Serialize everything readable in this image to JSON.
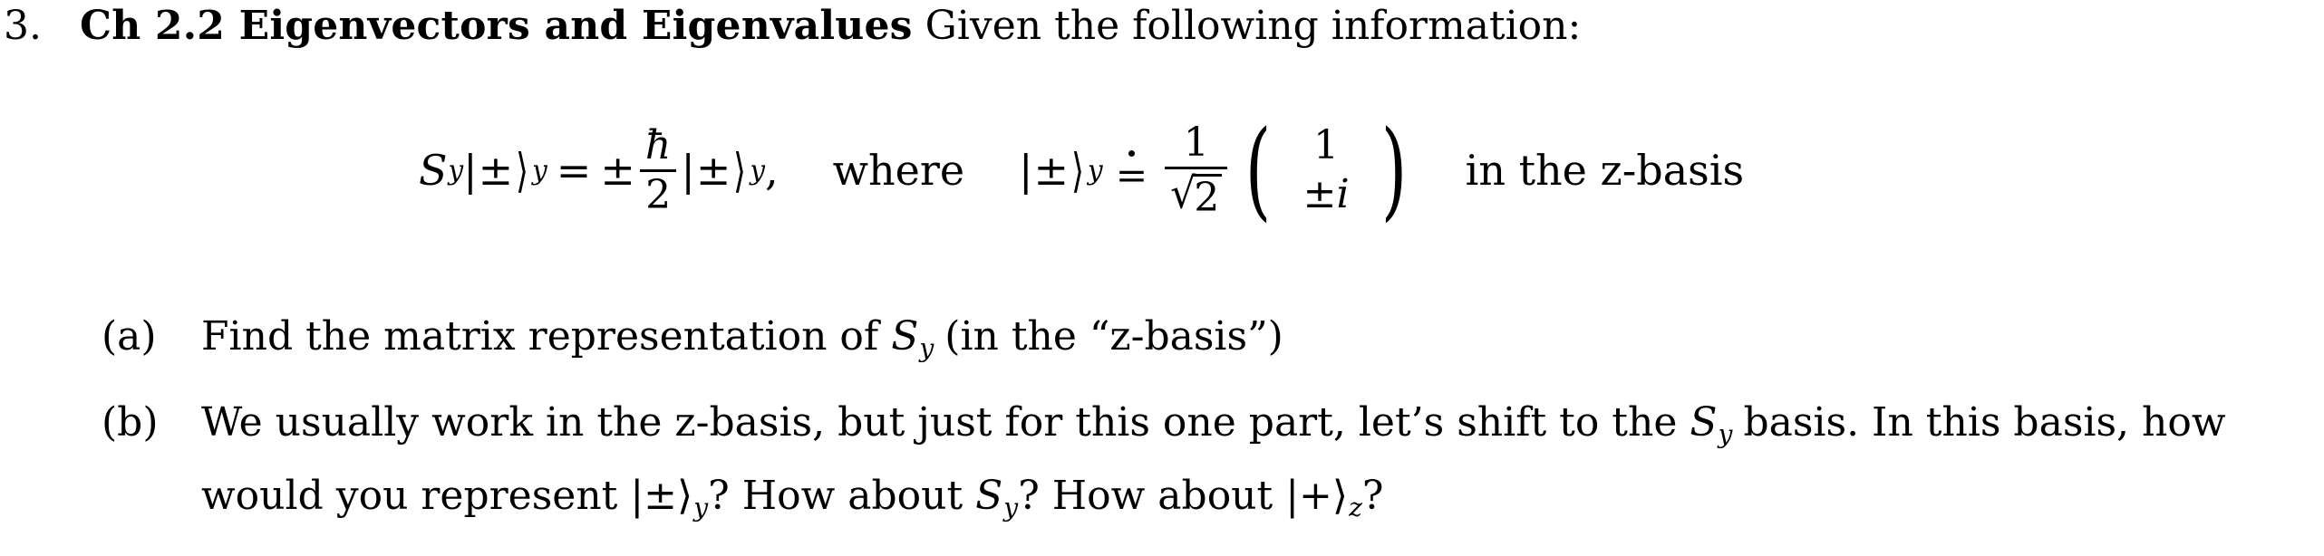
{
  "document": {
    "type": "physics-homework-problem",
    "text_color": "#000000",
    "background_color": "#ffffff"
  },
  "problem": {
    "number": "3.",
    "title": "Ch 2.2 Eigenvectors and Eigenvalues",
    "intro": "Given the following information:"
  },
  "equation": {
    "lhs": {
      "operator": "S",
      "operator_subscript": "y",
      "ket_open": "|",
      "ket_value": "±",
      "ket_close": "⟩",
      "ket_subscript": "y"
    },
    "equals": "=",
    "rhs": {
      "sign": "±",
      "fraction_numerator": "ħ",
      "fraction_denominator": "2",
      "ket_open": "|",
      "ket_value": "±",
      "ket_close": "⟩",
      "ket_subscript": "y",
      "comma": ","
    },
    "connector": "where",
    "definition": {
      "ket_open": "|",
      "ket_value": "±",
      "ket_close": "⟩",
      "ket_subscript": "y",
      "relation": "≐",
      "coefficient_numerator": "1",
      "coefficient_radical": "√",
      "coefficient_radicand": "2",
      "paren_left": "(",
      "paren_right": ")",
      "vector_top": "1",
      "vector_bottom": "±i",
      "vector_bottom_sign": "±",
      "vector_bottom_symbol": "i"
    },
    "trailing_text": "in the z-basis"
  },
  "parts": [
    {
      "label": "(a)",
      "segments": [
        {
          "kind": "text",
          "value": "Find the matrix representation of "
        },
        {
          "kind": "math",
          "value": "S",
          "sub": "y"
        },
        {
          "kind": "text",
          "value": " (in the “z-basis”)"
        }
      ],
      "plain_text": "Find the matrix representation of S_y (in the “z-basis”)"
    },
    {
      "label": "(b)",
      "segments": [
        {
          "kind": "text",
          "value": "We usually work in the z-basis, but just for this one part, let’s shift to the "
        },
        {
          "kind": "math",
          "value": "S",
          "sub": "y"
        },
        {
          "kind": "text",
          "value": " basis. In this basis, how would you represent "
        },
        {
          "kind": "math",
          "value": "|±⟩",
          "sub": "y"
        },
        {
          "kind": "text",
          "value": "? How about "
        },
        {
          "kind": "math",
          "value": "S",
          "sub": "y"
        },
        {
          "kind": "text",
          "value": "? How about "
        },
        {
          "kind": "math",
          "value": "|+⟩",
          "sub": "z"
        },
        {
          "kind": "text",
          "value": "?"
        }
      ],
      "plain_text": "We usually work in the z-basis, but just for this one part, let’s shift to the S_y basis. In this basis, how would you represent |±⟩_y? How about S_y? How about |+⟩_z?"
    }
  ],
  "part_a_text": {
    "before_sym": "Find the matrix representation of",
    "symbol": "S",
    "symbol_sub": "y",
    "after_sym": "(in the “z-basis”)"
  },
  "part_b_text": {
    "seg1": "We usually work in the z-basis, but just for this one part, let’s shift to the",
    "sym1": "S",
    "sym1_sub": "y",
    "seg2": "basis. In this basis, how would you represent",
    "sym2_ket": "|±⟩",
    "sym2_sub": "y",
    "seg3": "? How about",
    "sym3": "S",
    "sym3_sub": "y",
    "seg4": "? How about",
    "sym4_ket": "|+⟩",
    "sym4_sub": "z",
    "seg5": "?"
  }
}
